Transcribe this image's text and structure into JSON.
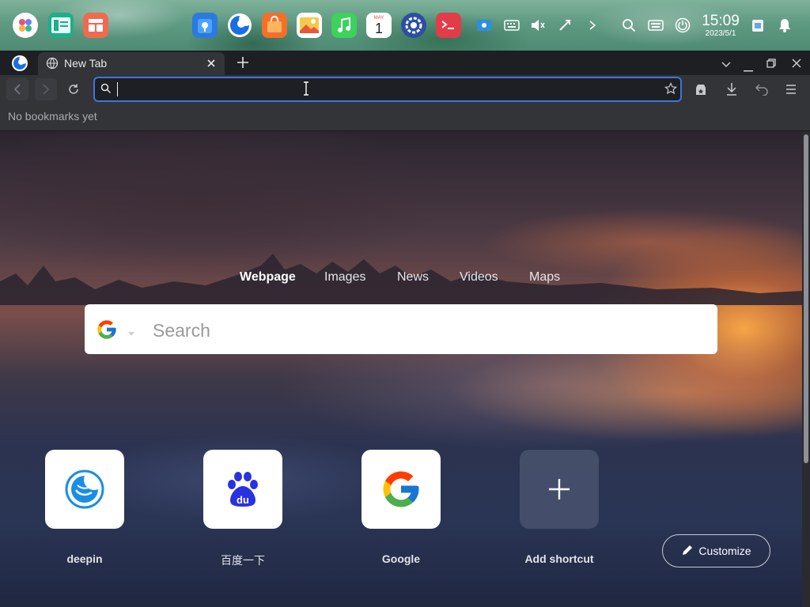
{
  "dock": {
    "apps": [
      {
        "name": "launcher-icon"
      },
      {
        "name": "multitasking-view-icon"
      },
      {
        "name": "app-store-icon"
      },
      {
        "name": "file-manager-icon"
      },
      {
        "name": "browser-icon"
      },
      {
        "name": "package-icon"
      },
      {
        "name": "image-viewer-icon"
      },
      {
        "name": "music-icon"
      },
      {
        "name": "calendar-icon",
        "date_day": "1"
      },
      {
        "name": "control-center-icon"
      },
      {
        "name": "terminal-icon"
      }
    ],
    "clock": {
      "time": "15:09",
      "date": "2023/5/1"
    }
  },
  "browser": {
    "tab": {
      "title": "New Tab"
    },
    "url": {
      "value": ""
    },
    "bookmarks_bar": {
      "empty_text": "No bookmarks yet"
    }
  },
  "newtab": {
    "search_tabs": [
      "Webpage",
      "Images",
      "News",
      "Videos",
      "Maps"
    ],
    "active_search_tab": "Webpage",
    "search_placeholder": "Search",
    "shortcuts": [
      {
        "label": "deepin"
      },
      {
        "label": "百度一下"
      },
      {
        "label": "Google"
      },
      {
        "label": "Add shortcut"
      }
    ],
    "customize_label": "Customize"
  },
  "colors": {
    "accent": "#3d76dd",
    "toolbar": "#323438",
    "tabbar": "#1e1f23"
  }
}
